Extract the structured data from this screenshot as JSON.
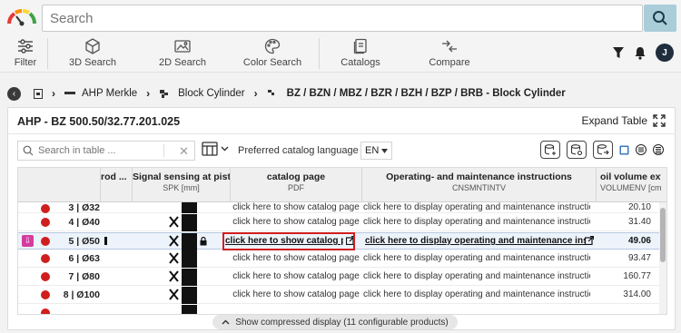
{
  "search": {
    "placeholder": "Search"
  },
  "toolbar": {
    "filter": "Filter",
    "search3d": "3D Search",
    "search2d": "2D Search",
    "color": "Color Search",
    "catalogs": "Catalogs",
    "compare": "Compare",
    "avatar_initial": "J"
  },
  "breadcrumb": {
    "items": [
      "AHP Merkle",
      "Block Cylinder",
      "BZ / BZN / MBZ / BZR / BZH / BZP / BRB - Block Cylinder"
    ]
  },
  "panel": {
    "title": "AHP - BZ 500.50/32.77.201.025",
    "expand_label": "Expand Table",
    "table_search_placeholder": "Search in table ...",
    "pref_language_label": "Preferred catalog language",
    "language": "EN",
    "compress_label": "Show compressed display (11 configurable products)"
  },
  "table": {
    "headers": [
      {
        "title": "rod ...",
        "sub": ""
      },
      {
        "title": "Signal sensing at pist...",
        "sub": "SPK [mm]"
      },
      {
        "title": "catalog page",
        "sub": "PDF"
      },
      {
        "title": "Operating- and maintenance instructions",
        "sub": "CNSMNTINTV"
      },
      {
        "title": "oil volume exte",
        "sub": "VOLUMENV [cm³]"
      }
    ],
    "rows": [
      {
        "label": "3 | Ø32",
        "catalog": "click here to show catalog page",
        "operating": "click here to display operating and maintenance instructions",
        "oil": "20.10"
      },
      {
        "label": "4 | Ø40",
        "catalog": "click here to show catalog page",
        "operating": "click here to display operating and maintenance instructions",
        "oil": "31.40"
      },
      {
        "label": "5 | Ø50",
        "catalog": "click here to show catalog page",
        "operating": "click here to display operating and maintenance instructions",
        "oil": "49.06"
      },
      {
        "label": "6 | Ø63",
        "catalog": "click here to show catalog page",
        "operating": "click here to display operating and maintenance instructions",
        "oil": "93.47"
      },
      {
        "label": "7 | Ø80",
        "catalog": "click here to show catalog page",
        "operating": "click here to display operating and maintenance instructions",
        "oil": "160.77"
      },
      {
        "label": "8 | Ø100",
        "catalog": "click here to show catalog page",
        "operating": "click here to display operating and maintenance instructions",
        "oil": "314.00"
      }
    ]
  },
  "colors": {
    "accent": "#a9cdd9",
    "status_dot": "#d01e1e",
    "highlight": "#d01e1e",
    "selected_marker": "#d43ca0"
  }
}
